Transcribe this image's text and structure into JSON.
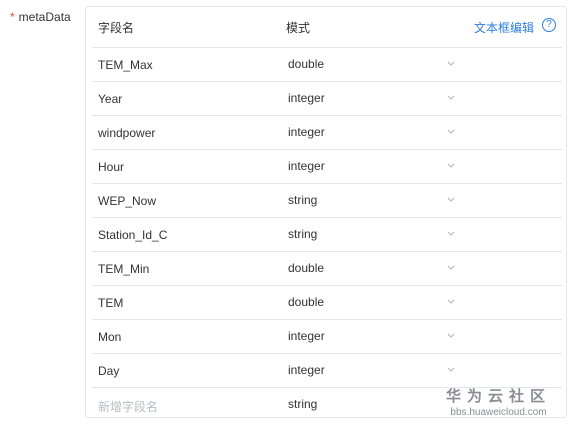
{
  "field": {
    "required_mark": "*",
    "label": "metaData"
  },
  "table": {
    "header_name": "字段名",
    "header_type": "模式",
    "edit_link": "文本框编辑",
    "help_icon": "?"
  },
  "rows": [
    {
      "name": "TEM_Max",
      "type": "double"
    },
    {
      "name": "Year",
      "type": "integer"
    },
    {
      "name": "windpower",
      "type": "integer"
    },
    {
      "name": "Hour",
      "type": "integer"
    },
    {
      "name": "WEP_Now",
      "type": "string"
    },
    {
      "name": "Station_Id_C",
      "type": "string"
    },
    {
      "name": "TEM_Min",
      "type": "double"
    },
    {
      "name": "TEM",
      "type": "double"
    },
    {
      "name": "Mon",
      "type": "integer"
    },
    {
      "name": "Day",
      "type": "integer"
    }
  ],
  "new_row": {
    "placeholder": "新增字段名",
    "type": "string"
  },
  "watermark": {
    "title": "华为云社区",
    "url": "bbs.huaweicloud.com"
  },
  "colors": {
    "accent": "#2d7de2",
    "required": "#e84e40",
    "border": "#e3e6eb"
  }
}
